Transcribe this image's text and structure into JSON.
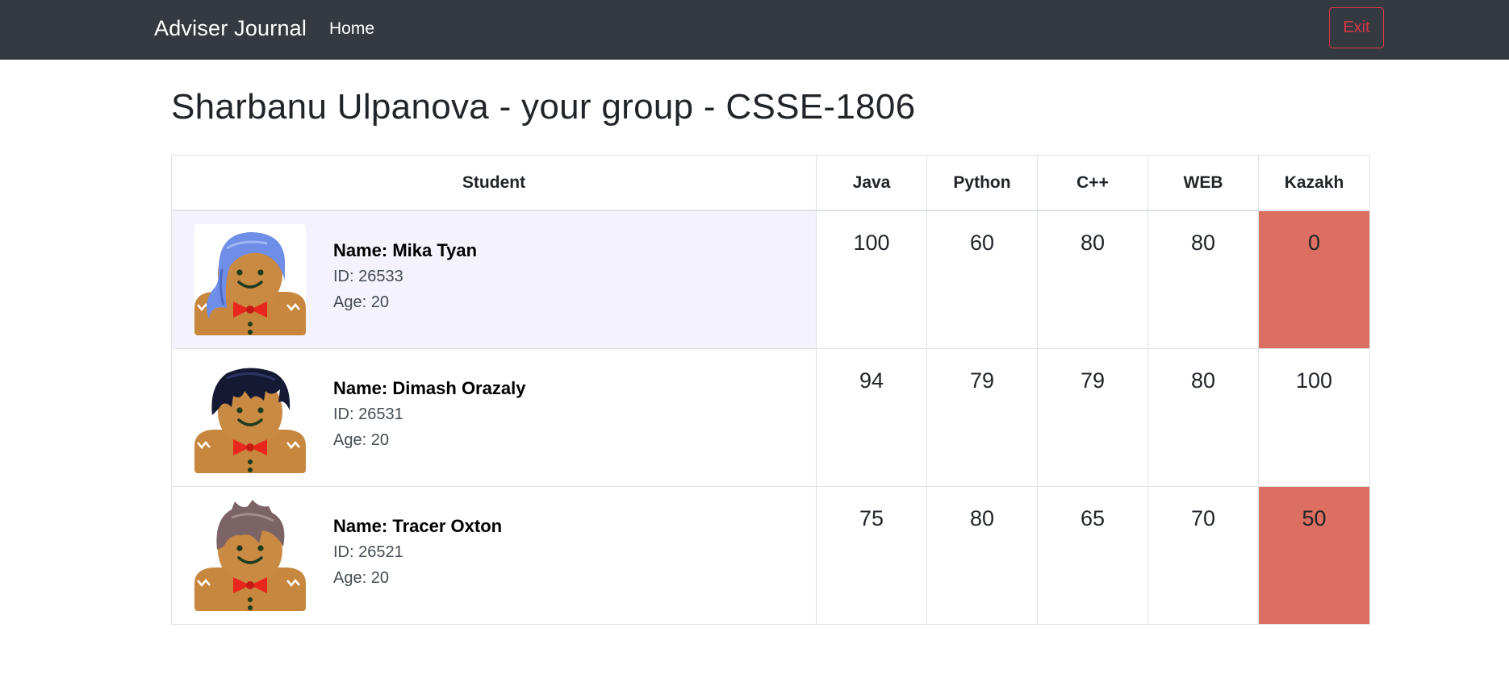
{
  "navbar": {
    "brand": "Adviser Journal",
    "home_link": "Home",
    "exit_button": "Exit"
  },
  "page": {
    "title": "Sharbanu Ulpanova - your group - CSSE-1806"
  },
  "table": {
    "headers": [
      "Student",
      "Java",
      "Python",
      "C++",
      "WEB",
      "Kazakh"
    ],
    "rows": [
      {
        "name": "Name: Mika Tyan",
        "id": "ID: 26533",
        "age": "Age: 20",
        "avatar": "gingerbread-blue-hair-icon",
        "grades": [
          "100",
          "60",
          "80",
          "80",
          "0"
        ],
        "failed": [
          false,
          false,
          false,
          false,
          true
        ],
        "highlighted": true
      },
      {
        "name": "Name: Dimash Orazaly",
        "id": "ID: 26531",
        "age": "Age: 20",
        "avatar": "gingerbread-black-hair-icon",
        "grades": [
          "94",
          "79",
          "79",
          "80",
          "100"
        ],
        "failed": [
          false,
          false,
          false,
          false,
          false
        ],
        "highlighted": false
      },
      {
        "name": "Name: Tracer Oxton",
        "id": "ID: 26521",
        "age": "Age: 20",
        "avatar": "gingerbread-brown-hair-icon",
        "grades": [
          "75",
          "80",
          "65",
          "70",
          "50"
        ],
        "failed": [
          false,
          false,
          false,
          false,
          true
        ],
        "highlighted": false
      }
    ]
  },
  "colors": {
    "navbar_bg": "#343a40",
    "exit_red": "#dc3545",
    "failed_cell": "#dc6f61",
    "highlight_row": "#f4f2fb"
  }
}
